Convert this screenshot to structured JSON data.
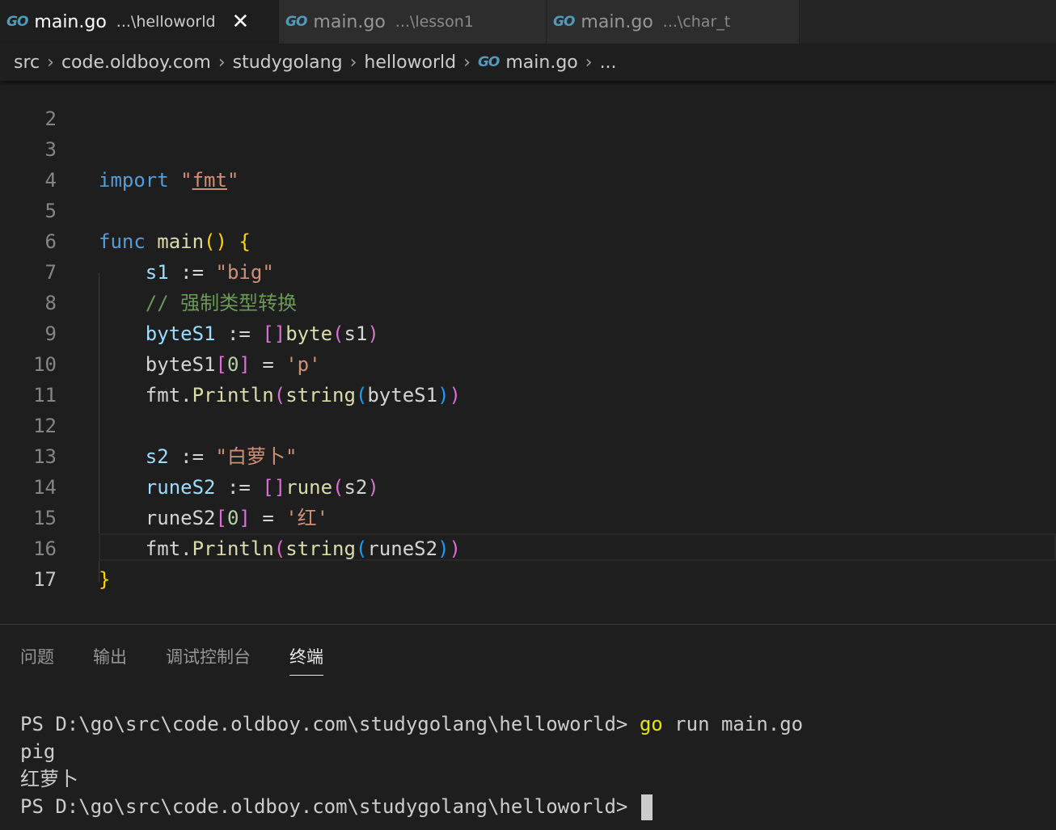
{
  "tabs": [
    {
      "icon": "GO",
      "name": "main.go",
      "path": "...\\helloworld",
      "close": "✕"
    },
    {
      "icon": "GO",
      "name": "main.go",
      "path": "...\\lesson1"
    },
    {
      "icon": "GO",
      "name": "main.go",
      "path": "...\\char_t"
    }
  ],
  "breadcrumb": {
    "items": [
      "src",
      "code.oldboy.com",
      "studygolang",
      "helloworld"
    ],
    "file": "main.go",
    "more": "...",
    "separator": "›",
    "icon": "GO"
  },
  "editor": {
    "line_numbers": [
      "2",
      "3",
      "4",
      "5",
      "6",
      "7",
      "8",
      "9",
      "10",
      "11",
      "12",
      "13",
      "14",
      "15",
      "16",
      "17"
    ],
    "code": {
      "import_kw": "import",
      "import_open": "\"",
      "import_pkg": "fmt",
      "import_close": "\"",
      "func_kw": "func",
      "main_fn": "main",
      "open_paren": "(",
      "close_paren": ")",
      "open_brace": "{",
      "close_brace": "}",
      "s1_var": "s1",
      "assign": ":=",
      "s1_value": "\"big\"",
      "comment": "// 强制类型转换",
      "bytes1_var": "byteS1",
      "open_bracket": "[",
      "close_bracket": "]",
      "byte_type": "byte",
      "s1_ref": "s1",
      "bytes1_ref": "byteS1",
      "zero": "0",
      "eq": "=",
      "p_char": "'p'",
      "fmt_pkg": "fmt.",
      "println_fn": "Println",
      "string_fn": "string",
      "s2_var": "s2",
      "s2_value": "\"白萝卜\"",
      "runes2_var": "runeS2",
      "rune_type": "rune",
      "s2_ref": "s2",
      "runes2_ref": "runeS2",
      "hong_char": "'红'"
    }
  },
  "panel": {
    "tabs": [
      "问题",
      "输出",
      "调试控制台",
      "终端"
    ],
    "active_tab": "终端",
    "terminal": {
      "prompt": "PS D:\\go\\src\\code.oldboy.com\\studygolang\\helloworld> ",
      "cmd_go": "go",
      "cmd_rest": " run main.go",
      "output1": "pig",
      "output2": "红萝卜"
    }
  },
  "colors": {
    "keyword": "#569cd6",
    "function": "#dcdcaa",
    "string": "#ce9178",
    "variable": "#9cdcfe",
    "comment": "#6a9955",
    "number": "#b5cea8",
    "bracket_gold": "#ffd700",
    "bracket_purple": "#da70d6",
    "bracket_blue": "#179fff",
    "go_icon": "#519aba",
    "go_cmd": "#e5e510"
  },
  "icons": {
    "go_file": "go-file-icon",
    "close": "close-icon",
    "chevron": "chevron-right-icon"
  }
}
